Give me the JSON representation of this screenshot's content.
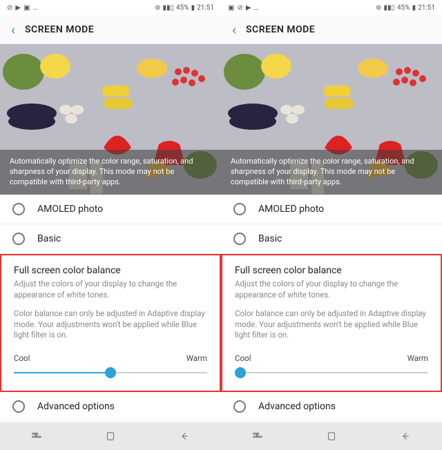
{
  "status": {
    "battery_pct": "45%",
    "time": "21:51"
  },
  "header": {
    "title": "SCREEN MODE"
  },
  "preview": {
    "caption": "Automatically optimize the color range, saturation, and sharpness of your display. This mode may not be compatible with third-party apps."
  },
  "modes": {
    "amoled_photo": "AMOLED photo",
    "basic": "Basic"
  },
  "color_balance": {
    "title": "Full screen color balance",
    "desc": "Adjust the colors of your display to change the appearance of white tones.",
    "note": "Color balance can only be adjusted in Adaptive display mode. Your adjustments won't be applied while Blue light filter is on.",
    "cool_label": "Cool",
    "warm_label": "Warm"
  },
  "advanced": {
    "label": "Advanced options"
  },
  "screens": [
    {
      "slider_pct": 50
    },
    {
      "slider_pct": 3
    }
  ]
}
